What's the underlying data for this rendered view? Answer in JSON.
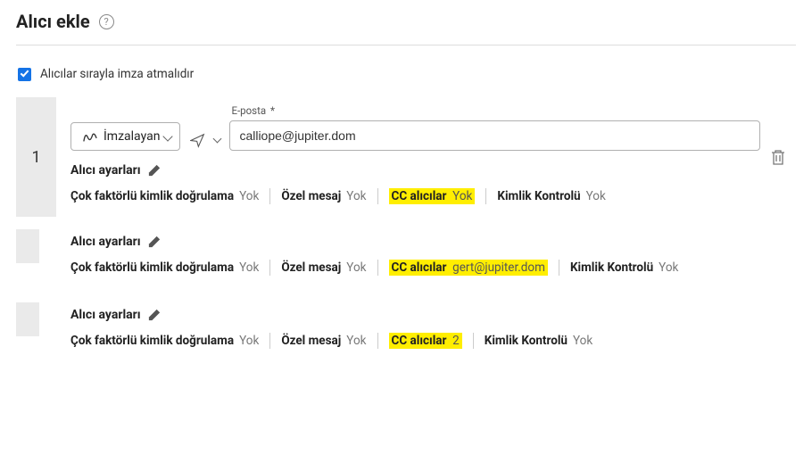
{
  "header": {
    "title": "Alıcı ekle"
  },
  "sequential": {
    "label": "Alıcılar sırayla imza atmalıdır",
    "checked": true
  },
  "email_label": "E-posta",
  "settings_title": "Alıcı ayarları",
  "detail_labels": {
    "mfa": "Çok faktörlü kimlik doğrulama",
    "private_msg": "Özel mesaj",
    "cc": "CC alıcılar",
    "identity": "Kimlik Kontrolü"
  },
  "recipients": [
    {
      "number": "1",
      "role": "İmzalayan",
      "email": "calliope@jupiter.dom",
      "mfa": "Yok",
      "private_msg": "Yok",
      "cc": "Yok",
      "identity": "Yok"
    },
    {
      "mfa": "Yok",
      "private_msg": "Yok",
      "cc": "gert@jupiter.dom",
      "identity": "Yok"
    },
    {
      "mfa": "Yok",
      "private_msg": "Yok",
      "cc": "2",
      "identity": "Yok"
    }
  ]
}
